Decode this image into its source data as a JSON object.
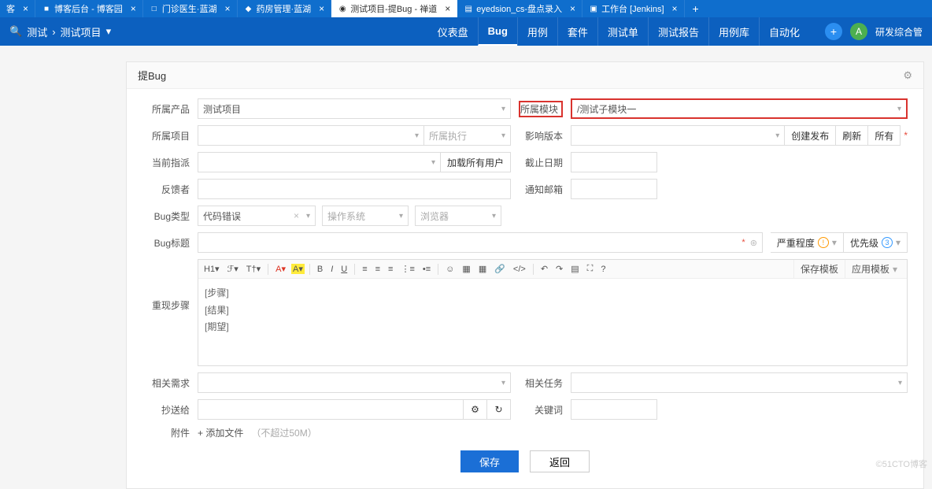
{
  "tabs": [
    {
      "label": "客",
      "suffix": ""
    },
    {
      "label": "博客后台 - 博客园",
      "icon": "■"
    },
    {
      "label": "门诊医生·蓝湖",
      "icon": "□"
    },
    {
      "label": "药房管理·蓝湖",
      "icon": "◆"
    },
    {
      "label": "测试项目-提Bug - 禅道",
      "icon": "◉"
    },
    {
      "label": "eyedsion_cs-盘点录入",
      "icon": "▤"
    },
    {
      "label": "工作台 [Jenkins]",
      "icon": "▣"
    }
  ],
  "tab_add": "+",
  "breadcrumb": {
    "icon": "🔍",
    "a": "测试",
    "sep": "›",
    "b": "测试项目",
    "caret": "▾"
  },
  "nav": {
    "items": [
      "仪表盘",
      "Bug",
      "用例",
      "套件",
      "测试单",
      "测试报告",
      "用例库",
      "自动化"
    ],
    "active": 1,
    "plus": "+",
    "avatar": "A",
    "team": "研发综合管"
  },
  "panel": {
    "title": "提Bug",
    "gear": "⚙"
  },
  "labels": {
    "product": "所属产品",
    "module": "所属模块",
    "project": "所属项目",
    "exec": "所属执行",
    "version": "影响版本",
    "create": "创建发布",
    "refresh": "刷新",
    "all": "所有",
    "assign": "当前指派",
    "loadall": "加载所有用户",
    "deadline": "截止日期",
    "feedback": "反馈者",
    "mail": "通知邮箱",
    "bugtype": "Bug类型",
    "os": "操作系统",
    "browser": "浏览器",
    "title": "Bug标题",
    "severity": "严重程度",
    "priority": "优先级",
    "steps": "重现步骤",
    "story": "相关需求",
    "task": "相关任务",
    "cc": "抄送给",
    "keywords": "关键词",
    "attach": "附件",
    "addfile": "+ 添加文件",
    "filehint": "（不超过50M）",
    "save": "保存",
    "back": "返回"
  },
  "values": {
    "product": "测试项目",
    "module": "/测试子模块一",
    "bugtype": "代码错误",
    "title_asterisk": "*",
    "sev_num": "",
    "pri_num": "3",
    "save_tpl": "保存模板",
    "use_tpl": "应用模板"
  },
  "editor": {
    "steps_1": "[步骤]",
    "steps_2": "[结果]",
    "steps_3": "[期望]"
  },
  "toolbar": {
    "h1": "H1▾",
    "format": "ℱ▾",
    "tt": "T†▾",
    "a": "A▾",
    "aHL": "A▾",
    "b": "B",
    "i": "I",
    "u": "U",
    "al": "≡",
    "ac": "≡",
    "ar": "≡",
    "ol": "⋮≡",
    "ul": "•≡",
    "emoji": "☺",
    "img": "▦",
    "table": "▦",
    "link": "🔗",
    "code": "</>",
    "undo": "↶",
    "redo": "↷",
    "src": "▤",
    "full": "⛶",
    "help": "?"
  },
  "watermark": "©51CTO博客"
}
